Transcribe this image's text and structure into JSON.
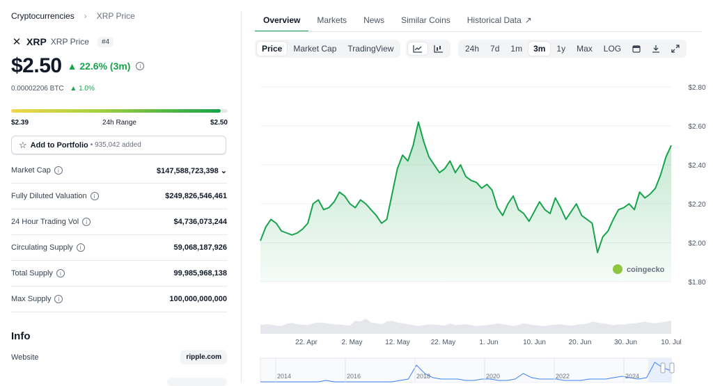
{
  "breadcrumb": {
    "root": "Cryptocurrencies",
    "current": "XRP Price"
  },
  "coin": {
    "symbol": "XRP",
    "name": "XRP Price",
    "rank": "#4"
  },
  "price": {
    "value": "$2.50",
    "change": "22.6% (3m)",
    "btc": "0.00002206 BTC",
    "btc_change": "1.0%"
  },
  "range": {
    "low": "$2.39",
    "label": "24h Range",
    "high": "$2.50",
    "position": 0.97
  },
  "portfolio": {
    "label": "Add to Portfolio",
    "count": "• 935,042 added"
  },
  "stats": [
    {
      "label": "Market Cap",
      "value": "$147,588,723,398"
    },
    {
      "label": "Fully Diluted Valuation",
      "value": "$249,826,546,461"
    },
    {
      "label": "24 Hour Trading Vol",
      "value": "$4,736,073,244"
    },
    {
      "label": "Circulating Supply",
      "value": "59,068,187,926"
    },
    {
      "label": "Total Supply",
      "value": "99,985,968,138"
    },
    {
      "label": "Max Supply",
      "value": "100,000,000,000"
    }
  ],
  "info": {
    "heading": "Info",
    "website_label": "Website",
    "website": "ripple.com"
  },
  "tabs": [
    "Overview",
    "Markets",
    "News",
    "Similar Coins",
    "Historical Data"
  ],
  "chart_types": [
    "Price",
    "Market Cap",
    "TradingView"
  ],
  "ranges": [
    "24h",
    "7d",
    "1m",
    "3m",
    "1y",
    "Max",
    "LOG"
  ],
  "colors": {
    "up": "#16a34a",
    "accent": "#16a34a"
  },
  "chart_data": {
    "type": "area",
    "watermark": "coingecko",
    "y_ticks": [
      "$2.80",
      "$2.60",
      "$2.40",
      "$2.20",
      "$2.00",
      "$1.80"
    ],
    "ylim": [
      1.8,
      2.8
    ],
    "x_ticks": [
      "22. Apr",
      "2. May",
      "12. May",
      "22. May",
      "1. Jun",
      "10. Jun",
      "20. Jun",
      "30. Jun",
      "10. Jul"
    ],
    "series": [
      {
        "values": [
          2.01,
          2.08,
          2.12,
          2.1,
          2.06,
          2.05,
          2.04,
          2.05,
          2.07,
          2.1,
          2.2,
          2.22,
          2.17,
          2.18,
          2.21,
          2.26,
          2.24,
          2.2,
          2.18,
          2.22,
          2.2,
          2.17,
          2.14,
          2.1,
          2.12,
          2.25,
          2.38,
          2.45,
          2.42,
          2.5,
          2.62,
          2.52,
          2.44,
          2.4,
          2.36,
          2.38,
          2.42,
          2.36,
          2.4,
          2.34,
          2.32,
          2.31,
          2.28,
          2.3,
          2.27,
          2.18,
          2.14,
          2.2,
          2.24,
          2.17,
          2.15,
          2.11,
          2.16,
          2.21,
          2.17,
          2.15,
          2.23,
          2.18,
          2.12,
          2.16,
          2.2,
          2.14,
          2.12,
          2.1,
          1.95,
          2.03,
          2.06,
          2.12,
          2.17,
          2.18,
          2.2,
          2.17,
          2.26,
          2.23,
          2.25,
          2.28,
          2.35,
          2.44,
          2.5
        ]
      }
    ],
    "volume": [
      20,
      22,
      21,
      19,
      18,
      23,
      25,
      22,
      21,
      20,
      24,
      26,
      25,
      23,
      22,
      21,
      20,
      19,
      30,
      28,
      35,
      26,
      24,
      22,
      28,
      30,
      26,
      24,
      22,
      20,
      18,
      20,
      22,
      21,
      20,
      19,
      23,
      20,
      21,
      22,
      20,
      18,
      19,
      20,
      21,
      24,
      22,
      20,
      18,
      20,
      24,
      22,
      20,
      19,
      18,
      20,
      21,
      22,
      20,
      19,
      21,
      22,
      23,
      28,
      26,
      24,
      22,
      20,
      22,
      21,
      23,
      24,
      26,
      28,
      25,
      24,
      26,
      28,
      30
    ],
    "overview_labels": [
      "2014",
      "2016",
      "2018",
      "2020",
      "2022",
      "2024"
    ]
  }
}
